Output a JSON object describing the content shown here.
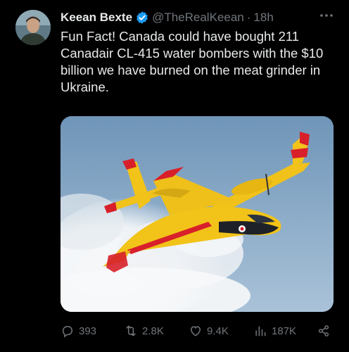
{
  "author": {
    "name": "Keean Bexte",
    "handle": "@TheRealKeean",
    "separator": "·",
    "time": "18h",
    "verified": true
  },
  "post": {
    "text": "Fun Fact! Canada could have bought 211 Canadair CL-415 water bombers with the $10 billion we have burned on the meat grinder in Ukraine."
  },
  "media": {
    "icon": "water-bomber-photo",
    "colors": {
      "sky": "#7fa3c2",
      "body": "#f2c318",
      "stripe": "#d8202a"
    }
  },
  "actions": {
    "replies": "393",
    "reposts": "2.8K",
    "likes": "9.4K",
    "views": "187K"
  },
  "colors": {
    "background": "#000000",
    "text": "#e7e9ea",
    "muted": "#71767b",
    "verified": "#1d9bf0"
  }
}
